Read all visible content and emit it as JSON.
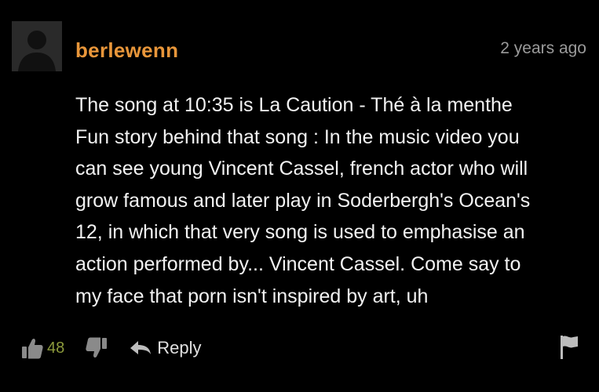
{
  "comment": {
    "username": "berlewenn",
    "timestamp": "2 years ago",
    "text": "The song at 10:35 is La Caution - Thé à la menthe\nFun story behind that song : In the music video you\ncan see young Vincent Cassel, french actor who will\ngrow famous and later play in Soderbergh's Ocean's\n12, in which that very song is used to emphasise an\naction performed by... Vincent Cassel. Come say to\nmy face that porn isn't inspired by art, uh"
  },
  "actions": {
    "like_count": "48",
    "reply_label": "Reply"
  },
  "icons": {
    "like": "thumbs-up-icon",
    "dislike": "thumbs-down-icon",
    "reply": "reply-arrow-icon",
    "flag": "flag-icon",
    "avatar": "default-user-avatar"
  },
  "colors": {
    "background": "#000000",
    "username": "#e8963a",
    "like_count": "#8c9a3c",
    "text": "#f2f2f2",
    "muted": "#9a9a9a"
  }
}
